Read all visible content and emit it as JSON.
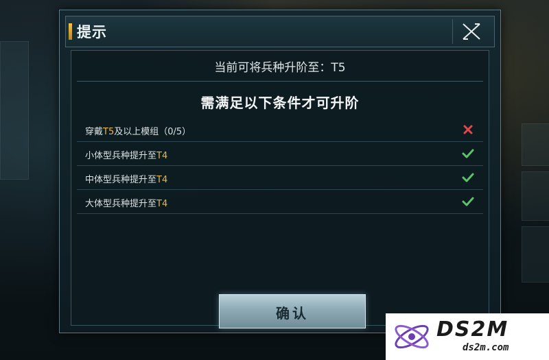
{
  "dialog": {
    "title": "提示",
    "upgrade_line": "当前可将兵种升阶至：T5",
    "section_title": "需满足以下条件才可升阶",
    "requirements": [
      {
        "prefix": "穿戴",
        "highlight": "T5",
        "suffix": "及以上模组（0/5）",
        "status": "not-met",
        "status_icon": "cross-icon"
      },
      {
        "prefix": "小体型兵种提升至",
        "highlight": "T4",
        "suffix": "",
        "status": "met",
        "status_icon": "check-icon"
      },
      {
        "prefix": "中体型兵种提升至",
        "highlight": "T4",
        "suffix": "",
        "status": "met",
        "status_icon": "check-icon"
      },
      {
        "prefix": "大体型兵种提升至",
        "highlight": "T4",
        "suffix": "",
        "status": "met",
        "status_icon": "check-icon"
      }
    ],
    "confirm_label": "确认"
  },
  "watermark": {
    "brand": "DS2M",
    "url": "ds2m.com"
  },
  "colors": {
    "highlight": "#e7b944",
    "check": "#5cc36a",
    "cross": "#e0484a",
    "title_accent": "#f0c44a"
  }
}
